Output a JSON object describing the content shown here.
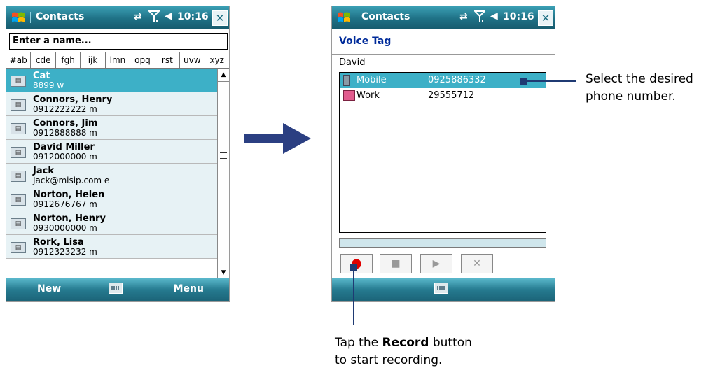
{
  "status": {
    "time": "10:16"
  },
  "left_screen": {
    "title": "Contacts",
    "search_placeholder": "Enter a name...",
    "alpha_tabs": [
      "#ab",
      "cde",
      "fgh",
      "ijk",
      "lmn",
      "opq",
      "rst",
      "uvw",
      "xyz"
    ],
    "contacts": [
      {
        "name": "Cat",
        "detail": "8899   w",
        "selected": true
      },
      {
        "name": "Connors, Henry",
        "detail": "0912222222   m"
      },
      {
        "name": "Connors, Jim",
        "detail": "0912888888   m"
      },
      {
        "name": "David Miller",
        "detail": "0912000000   m"
      },
      {
        "name": "Jack",
        "detail": "Jack@misip.com   e"
      },
      {
        "name": "Norton, Helen",
        "detail": "0912676767   m"
      },
      {
        "name": "Norton, Henry",
        "detail": "0930000000   m"
      },
      {
        "name": "Rork, Lisa",
        "detail": "0912323232   m"
      }
    ],
    "menu_left": "New",
    "menu_right": "Menu"
  },
  "right_screen": {
    "title": "Contacts",
    "heading": "Voice Tag",
    "contact_name": "David",
    "numbers": [
      {
        "label": "Mobile",
        "number": "0925886332",
        "selected": true,
        "icon": "mobile-phone-icon"
      },
      {
        "label": "Work",
        "number": "29555712",
        "selected": false,
        "icon": "work-briefcase-icon"
      }
    ],
    "controls": [
      "record",
      "stop",
      "play",
      "delete"
    ]
  },
  "callouts": {
    "select_line1": "Select the desired",
    "select_line2": "phone number.",
    "tap_pre": "Tap the ",
    "tap_bold": "Record",
    "tap_post": " button",
    "tap_line2": "to start recording."
  },
  "colors": {
    "title_bar": "#1f7186",
    "selection": "#3db0c7",
    "arrow": "#2b3f82",
    "heading": "#002b9a"
  }
}
